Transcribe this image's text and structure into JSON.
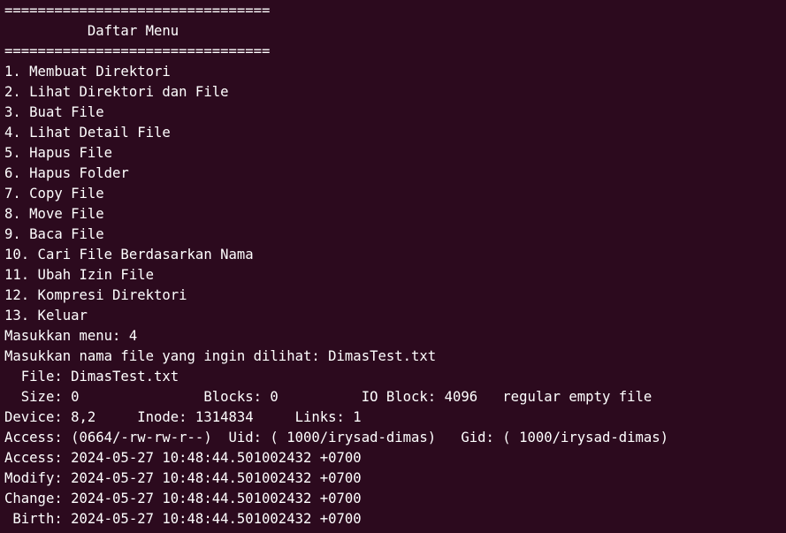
{
  "terminal": {
    "lines": [
      "================================",
      "          Daftar Menu",
      "================================",
      "1. Membuat Direktori",
      "2. Lihat Direktori dan File",
      "3. Buat File",
      "4. Lihat Detail File",
      "5. Hapus File",
      "6. Hapus Folder",
      "7. Copy File",
      "8. Move File",
      "9. Baca File",
      "10. Cari File Berdasarkan Nama",
      "11. Ubah Izin File",
      "12. Kompresi Direktori",
      "13. Keluar",
      "Masukkan menu: 4",
      "Masukkan nama file yang ingin dilihat: DimasTest.txt",
      "  File: DimasTest.txt",
      "  Size: 0               Blocks: 0          IO Block: 4096   regular empty file",
      "Device: 8,2     Inode: 1314834     Links: 1",
      "Access: (0664/-rw-rw-r--)  Uid: ( 1000/irysad-dimas)   Gid: ( 1000/irysad-dimas)",
      "Access: 2024-05-27 10:48:44.501002432 +0700",
      "Modify: 2024-05-27 10:48:44.501002432 +0700",
      "Change: 2024-05-27 10:48:44.501002432 +0700",
      " Birth: 2024-05-27 10:48:44.501002432 +0700"
    ]
  },
  "colors": {
    "background": "#2c0a1e",
    "foreground": "#ffffff"
  }
}
